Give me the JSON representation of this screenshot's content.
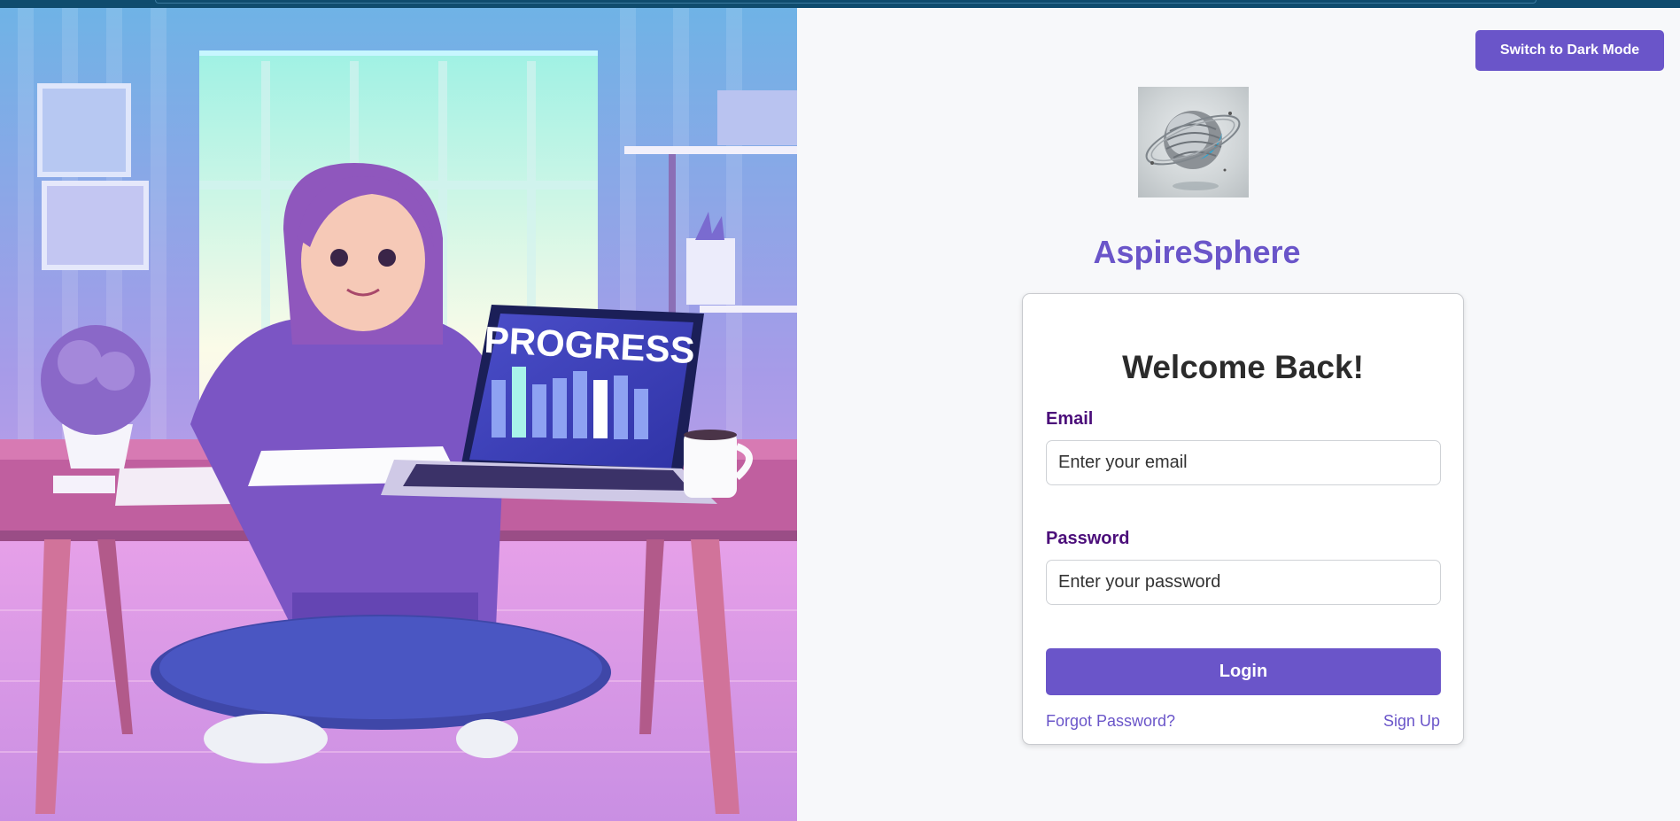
{
  "header": {
    "theme_toggle_label": "Switch to Dark Mode"
  },
  "hero": {
    "laptop_screen_text": "PROGRESS"
  },
  "brand": {
    "logo_icon": "planet-sphere-logo",
    "name": "AspireSphere",
    "accent_color": "#6a55c9"
  },
  "login_card": {
    "title": "Welcome Back!",
    "email_label": "Email",
    "email_placeholder": "Enter your email",
    "email_value": "",
    "password_label": "Password",
    "password_placeholder": "Enter your password",
    "password_value": "",
    "login_label": "Login",
    "forgot_label": "Forgot Password?",
    "signup_label": "Sign Up"
  }
}
